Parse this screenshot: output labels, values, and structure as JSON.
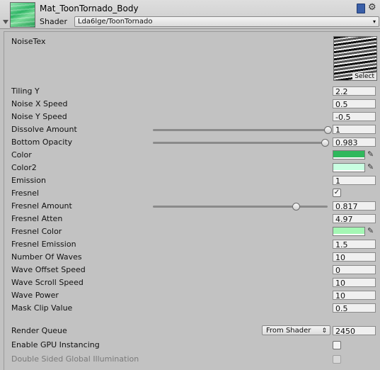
{
  "header": {
    "title": "Mat_ToonTornado_Body",
    "shader_label": "Shader",
    "shader_value": "Lda6lge/ToonTornado",
    "caret": "▾",
    "icons": [
      "material-thumbnail-icon",
      "help-book-icon",
      "gear-icon",
      "foldout-arrow-icon"
    ]
  },
  "noise_tex": {
    "label": "NoiseTex",
    "select": "Select"
  },
  "props": {
    "tiling_y": {
      "label": "Tiling Y",
      "value": "2.2"
    },
    "noise_x_speed": {
      "label": "Noise X Speed",
      "value": "0.5"
    },
    "noise_y_speed": {
      "label": "Noise Y Speed",
      "value": "-0.5"
    },
    "dissolve_amount": {
      "label": "Dissolve Amount",
      "value": "1",
      "slider_fraction": 1.0
    },
    "bottom_opacity": {
      "label": "Bottom Opacity",
      "value": "0.983",
      "slider_fraction": 0.983
    },
    "color": {
      "label": "Color",
      "swatch": "#2fb85c"
    },
    "color2": {
      "label": "Color2",
      "swatch": "#c8ffe1"
    },
    "emission": {
      "label": "Emission",
      "value": "1"
    },
    "fresnel": {
      "label": "Fresnel",
      "checked": true,
      "check_glyph": "✓"
    },
    "fresnel_amount": {
      "label": "Fresnel Amount",
      "value": "0.817",
      "slider_fraction": 0.817
    },
    "fresnel_atten": {
      "label": "Fresnel Atten",
      "value": "4.97"
    },
    "fresnel_color": {
      "label": "Fresnel Color",
      "swatch": "#a4f7b4"
    },
    "fresnel_emission": {
      "label": "Fresnel Emission",
      "value": "1.5"
    },
    "number_of_waves": {
      "label": "Number Of Waves",
      "value": "10"
    },
    "wave_offset_speed": {
      "label": "Wave Offset Speed",
      "value": "0"
    },
    "wave_scroll_speed": {
      "label": "Wave Scroll Speed",
      "value": "10"
    },
    "wave_power": {
      "label": "Wave Power",
      "value": "10"
    },
    "mask_clip_value": {
      "label": "Mask Clip Value",
      "value": "0.5"
    }
  },
  "render": {
    "queue_label": "Render Queue",
    "queue_mode": "From Shader",
    "queue_caret": "⇕",
    "queue_value": "2450",
    "gpu_instancing_label": "Enable GPU Instancing",
    "gpu_instancing_checked": false,
    "double_sided_gi_label": "Double Sided Global Illumination",
    "double_sided_gi_checked": false
  },
  "picker_glyph": "✎"
}
